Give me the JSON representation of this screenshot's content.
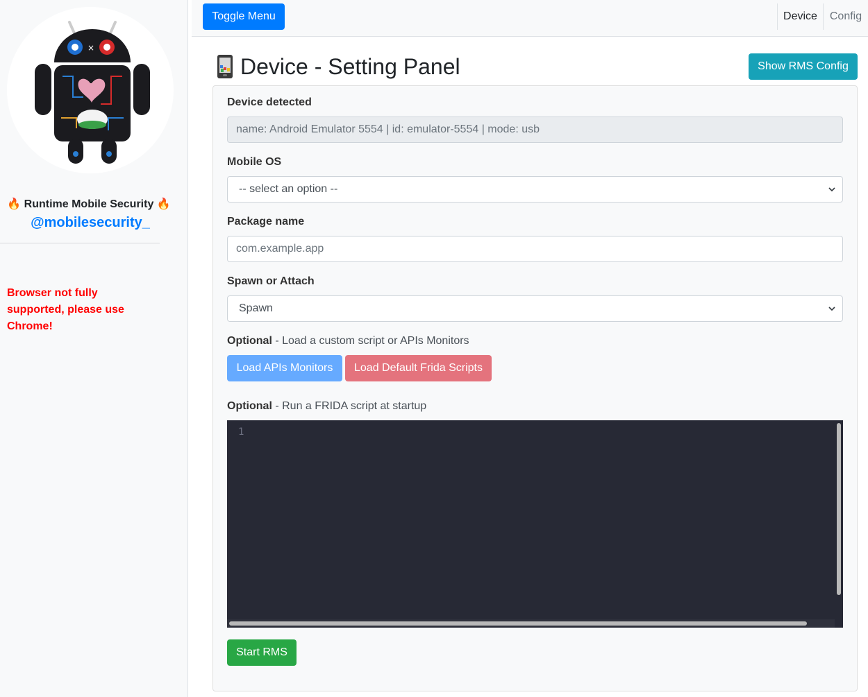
{
  "sidebar": {
    "brand_title": "🔥 Runtime Mobile Security 🔥",
    "brand_handle": "@mobilesecurity_",
    "warning": "Browser not fully supported, please use Chrome!"
  },
  "navbar": {
    "toggle_label": "Toggle Menu",
    "tabs": [
      {
        "label": "Device",
        "active": true
      },
      {
        "label": "Config",
        "active": false
      }
    ]
  },
  "main": {
    "title": "Device - Setting Panel",
    "show_config_label": "Show RMS Config",
    "device": {
      "label": "Device detected",
      "value": "name: Android Emulator 5554 | id: emulator-5554 | mode: usb"
    },
    "mobile_os": {
      "label": "Mobile OS",
      "selected": "-- select an option --"
    },
    "package": {
      "label": "Package name",
      "placeholder": "com.example.app"
    },
    "spawn_attach": {
      "label": "Spawn or Attach",
      "selected": "Spawn"
    },
    "optional_load": {
      "bold": "Optional",
      "text": " - Load a custom script or APIs Monitors"
    },
    "load_apis_label": "Load APIs Monitors",
    "load_frida_label": "Load Default Frida Scripts",
    "optional_run": {
      "bold": "Optional",
      "text": " - Run a FRIDA script at startup"
    },
    "editor": {
      "line_number": "1"
    },
    "start_label": "Start RMS"
  },
  "colors": {
    "primary": "#007bff",
    "info": "#17a2b8",
    "success": "#28a745",
    "danger_light": "#e4737d",
    "primary_light": "#66aaff",
    "editor_bg": "#272935",
    "warning_text": "#ff0000"
  },
  "icons": [
    "android-mascot-logo",
    "phone-icon",
    "chevron-down-icon"
  ]
}
